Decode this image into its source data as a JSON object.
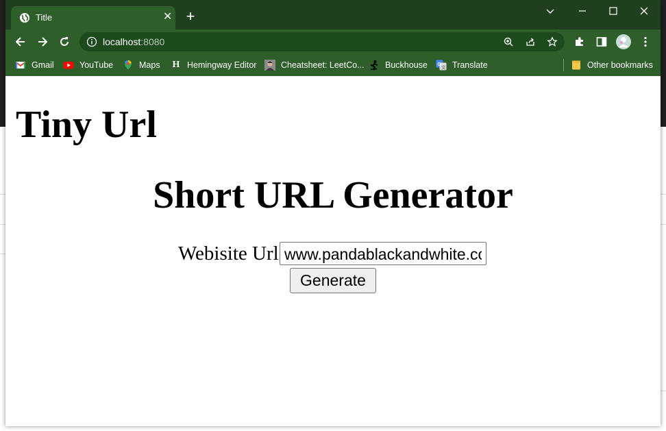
{
  "tab": {
    "title": "Title",
    "close_glyph": "✕",
    "favicon": "globe-icon"
  },
  "new_tab_glyph": "+",
  "window_controls": [
    "chevron-down-icon",
    "minimize-icon",
    "maximize-icon",
    "close-icon"
  ],
  "toolbar": {
    "back_icon": "back-arrow-icon",
    "forward_icon": "forward-arrow-icon",
    "reload_icon": "reload-icon",
    "url_host": "localhost",
    "url_port": ":8080",
    "omnibox_icons": [
      "zoom-icon",
      "share-icon",
      "star-icon"
    ],
    "extension_icons": [
      "puzzle-icon",
      "side-panel-icon",
      "profile-avatar",
      "more-menu-icon"
    ]
  },
  "bookmarks": [
    {
      "label": "Gmail",
      "icon": "gmail-icon"
    },
    {
      "label": "YouTube",
      "icon": "youtube-icon"
    },
    {
      "label": "Maps",
      "icon": "maps-icon"
    },
    {
      "label": "Hemingway Editor",
      "icon": "hemingway-icon"
    },
    {
      "label": "Cheatsheet: LeetCo...",
      "icon": "avatar-icon"
    },
    {
      "label": "Buckhouse",
      "icon": "skater-icon"
    },
    {
      "label": "Translate",
      "icon": "translate-icon"
    }
  ],
  "other_bookmarks": {
    "label": "Other bookmarks",
    "icon": "folder-icon"
  },
  "page": {
    "title": "Tiny Url",
    "heading": "Short URL Generator",
    "form": {
      "label": "Webisite Url",
      "input_value": "www.pandablackandwhite.com",
      "button_label": "Generate"
    }
  },
  "colors": {
    "titlebar": "#1f3f1f",
    "toolbar": "#2e5f2b",
    "omnibox": "#1d4a1c",
    "page_background": "#ffffff"
  }
}
